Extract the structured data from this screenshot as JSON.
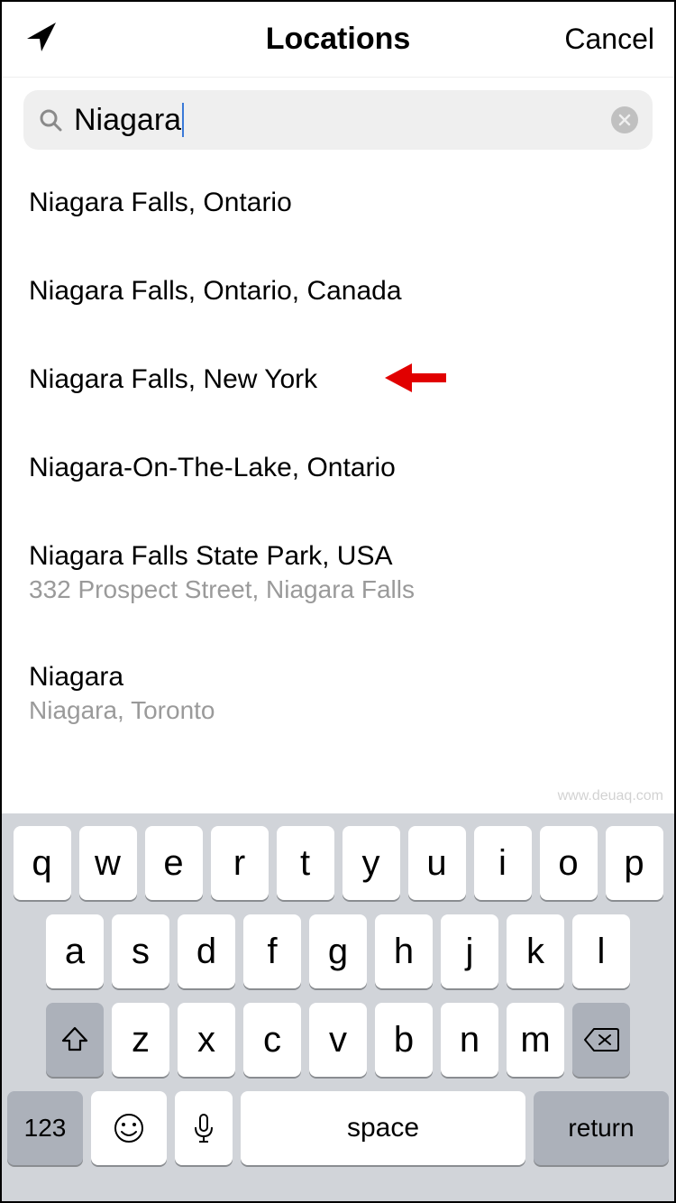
{
  "nav": {
    "title": "Locations",
    "cancel": "Cancel"
  },
  "search": {
    "value": "Niagara"
  },
  "results": [
    {
      "title": "Niagara Falls, Ontario",
      "subtitle": "",
      "highlighted": false
    },
    {
      "title": "Niagara Falls, Ontario, Canada",
      "subtitle": "",
      "highlighted": false
    },
    {
      "title": "Niagara Falls, New York",
      "subtitle": "",
      "highlighted": true
    },
    {
      "title": "Niagara-On-The-Lake, Ontario",
      "subtitle": "",
      "highlighted": false
    },
    {
      "title": "Niagara Falls State Park, USA",
      "subtitle": "332 Prospect Street, Niagara Falls",
      "highlighted": false
    },
    {
      "title": "Niagara",
      "subtitle": "Niagara, Toronto",
      "highlighted": false
    }
  ],
  "keyboard": {
    "row1": [
      "q",
      "w",
      "e",
      "r",
      "t",
      "y",
      "u",
      "i",
      "o",
      "p"
    ],
    "row2": [
      "a",
      "s",
      "d",
      "f",
      "g",
      "h",
      "j",
      "k",
      "l"
    ],
    "row3": [
      "z",
      "x",
      "c",
      "v",
      "b",
      "n",
      "m"
    ],
    "labels": {
      "numbers": "123",
      "space": "space",
      "return": "return"
    }
  },
  "watermark": "www.deuaq.com"
}
